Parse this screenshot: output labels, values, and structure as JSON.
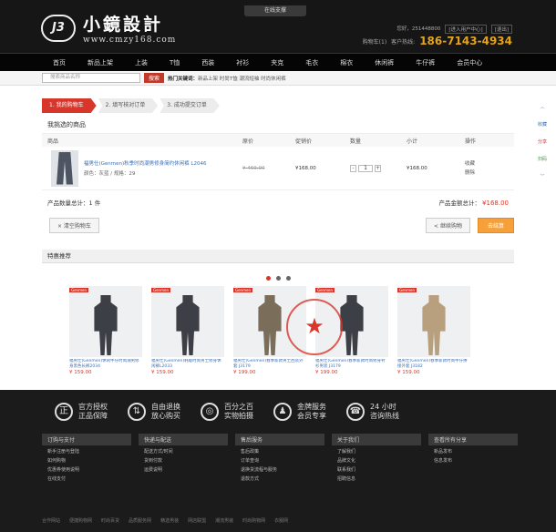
{
  "header": {
    "online_label": "在线支撑",
    "logo_text": "小鏡設計",
    "logo_mark": "J3",
    "url": "www.cmzy168.com",
    "links": [
      "您好，251448800",
      "[进入用户中心]",
      "[退出]"
    ],
    "cart_label": "购物车(1)",
    "hotline_label": "客户热线:",
    "hotline": "186-7143-4934"
  },
  "nav": [
    "首页",
    "新品上架",
    "上装",
    "T恤",
    "西装",
    "衬衫",
    "夹克",
    "毛衣",
    "棉衣",
    "休闲裤",
    "牛仔裤",
    "会员中心"
  ],
  "search": {
    "placeholder": "搜索商品名称",
    "button": "搜索",
    "hot_label": "热门关键词：",
    "hot_words": "新品上架 时尚T恤 潮流短袖 时尚休闲裤"
  },
  "steps": [
    "1. 我的购物车",
    "2. 填写核对订单",
    "3. 成功提交订单"
  ],
  "cart": {
    "title": "我挑选的商品",
    "columns": [
      "商品",
      "原价",
      "促销价",
      "数量",
      "小计",
      "操作"
    ],
    "item": {
      "name": "福男仕(Genmen)秋季时尚潮男修身简约休闲裤 L2046",
      "spec": "颜色：灰蓝 / 规格：29",
      "orig_price": "¥ 469.00",
      "price": "¥168.00",
      "qty": "1",
      "subtotal": "¥168.00",
      "actions": [
        "收藏",
        "删除"
      ]
    },
    "count_label": "产品数量总计：1 件",
    "total_label": "产品金额总计：",
    "total": "¥168.00",
    "clear_button": "× 清空购物车",
    "continue_button": "< 继续购物",
    "checkout_button": "去结算"
  },
  "recommend": {
    "title": "特惠推荐",
    "items": [
      {
        "title": "福男仕(Genmen)休闲牛仔时尚潮男修身黑色长裤2034",
        "price": "¥ 159.00"
      },
      {
        "title": "福男仕(Genmen)韩版时尚男士修身休闲裤L2033",
        "price": "¥ 159.00"
      },
      {
        "title": "福男仕(Genmen)春季新款男士西装外套 J3179",
        "price": "¥ 199.00"
      },
      {
        "title": "福男仕(Genmen)春季新款时尚修身衬衫男装 J3179",
        "price": "¥ 199.00"
      },
      {
        "title": "福男仕(Genmen)春季新款时尚牛仔拼接外套 J3182",
        "price": "¥ 159.00"
      }
    ]
  },
  "footer": {
    "guarantees": [
      {
        "icon": "genuine-icon",
        "glyph": "正",
        "line1": "官方授权",
        "line2": "正品保障"
      },
      {
        "icon": "return-icon",
        "glyph": "⇅",
        "line1": "自由退换",
        "line2": "放心购买"
      },
      {
        "icon": "camera-icon",
        "glyph": "◎",
        "line1": "百分之百",
        "line2": "实物拍摄"
      },
      {
        "icon": "member-icon",
        "glyph": "♟",
        "line1": "金牌服务",
        "line2": "会员专享"
      },
      {
        "icon": "phone-icon",
        "glyph": "☎",
        "line1": "24 小时",
        "line2": "咨询热线"
      }
    ],
    "columns": [
      {
        "title": "订购与支付",
        "links": [
          "新手注册与登陆",
          "如何购物",
          "优惠券使用说明",
          "在线支付"
        ]
      },
      {
        "title": "快递与配送",
        "links": [
          "配送方式/时间",
          "货到付款",
          "运费说明"
        ]
      },
      {
        "title": "售后服务",
        "links": [
          "售后政策",
          "订单查询",
          "退换货流程与服务",
          "退款方式"
        ]
      },
      {
        "title": "关于我们",
        "links": [
          "了解我们",
          "品牌文化",
          "联系我们",
          "招聘信息"
        ]
      },
      {
        "title": "查看所有分享",
        "links": [
          "新品发布",
          "信息发布"
        ]
      }
    ],
    "bottom_links": [
      "合作网站",
      "便捷购物网",
      "时尚百货",
      "品质服务网",
      "精选男装",
      "网店联盟",
      "潮流男装",
      "时尚购物网",
      "衣服网"
    ]
  },
  "side": [
    "收藏",
    "分享",
    "扫码"
  ]
}
